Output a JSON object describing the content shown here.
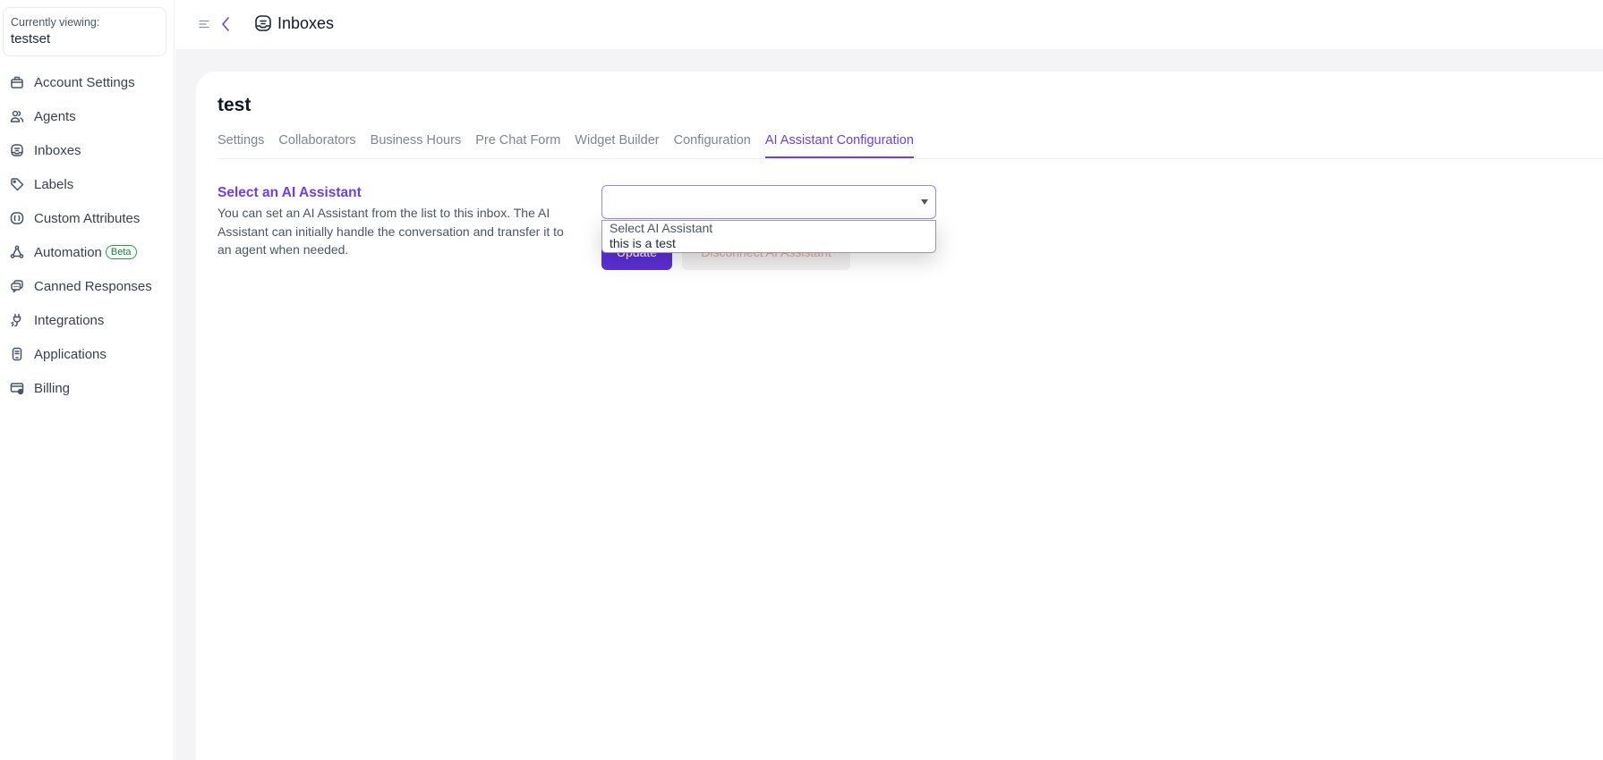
{
  "account": {
    "label": "Currently viewing:",
    "name": "testset"
  },
  "sidebar": {
    "items": [
      {
        "label": "Account Settings",
        "icon": "briefcase-icon"
      },
      {
        "label": "Agents",
        "icon": "users-icon"
      },
      {
        "label": "Inboxes",
        "icon": "inbox-icon"
      },
      {
        "label": "Labels",
        "icon": "tag-icon"
      },
      {
        "label": "Custom Attributes",
        "icon": "code-brackets-icon"
      },
      {
        "label": "Automation",
        "icon": "automation-icon",
        "badge": "Beta"
      },
      {
        "label": "Canned Responses",
        "icon": "chat-bubbles-icon"
      },
      {
        "label": "Integrations",
        "icon": "plug-icon"
      },
      {
        "label": "Applications",
        "icon": "app-icon"
      },
      {
        "label": "Billing",
        "icon": "billing-icon"
      }
    ]
  },
  "header": {
    "title": "Inboxes"
  },
  "page": {
    "title": "test",
    "tabs": [
      {
        "label": "Settings",
        "active": false
      },
      {
        "label": "Collaborators",
        "active": false
      },
      {
        "label": "Business Hours",
        "active": false
      },
      {
        "label": "Pre Chat Form",
        "active": false
      },
      {
        "label": "Widget Builder",
        "active": false
      },
      {
        "label": "Configuration",
        "active": false
      },
      {
        "label": "AI Assistant Configuration",
        "active": true
      }
    ]
  },
  "ai_assistant": {
    "section_title": "Select an AI Assistant",
    "description": "You can set an AI Assistant from the list to this inbox. The AI Assistant can initially handle the conversation and transfer it to an agent when needed.",
    "select_value": "",
    "options": [
      "Select AI Assistant",
      "this is a test"
    ],
    "update_label": "Update",
    "disconnect_label": "Disconnect AI Assistant"
  },
  "colors": {
    "accent": "#6d3fe6",
    "button_primary": "#5b2fd6",
    "beta_badge": "#22a046",
    "disconnect_text": "#e8a4a4"
  }
}
